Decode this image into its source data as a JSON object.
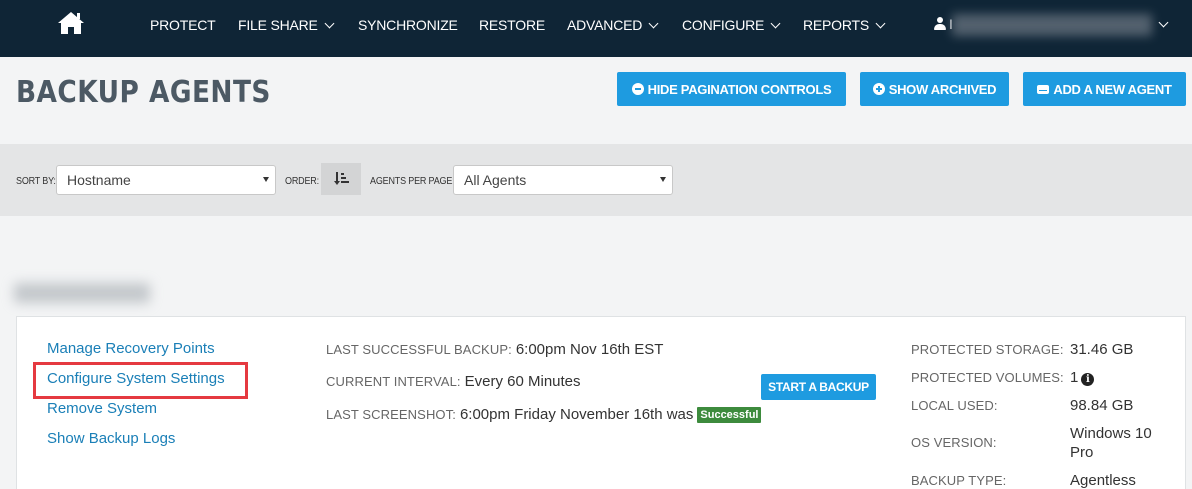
{
  "nav": {
    "items": [
      {
        "label": "PROTECT",
        "dropdown": false
      },
      {
        "label": "FILE SHARE",
        "dropdown": true
      },
      {
        "label": "SYNCHRONIZE",
        "dropdown": false
      },
      {
        "label": "RESTORE",
        "dropdown": false
      },
      {
        "label": "ADVANCED",
        "dropdown": true
      },
      {
        "label": "CONFIGURE",
        "dropdown": true
      },
      {
        "label": "REPORTS",
        "dropdown": true
      }
    ],
    "user_initial": "I",
    "icons": {
      "home": "home-icon",
      "user": "user-icon"
    }
  },
  "page": {
    "title": "BACKUP AGENTS",
    "buttons": {
      "hide_pagination": "HIDE PAGINATION CONTROLS",
      "show_archived": "SHOW ARCHIVED",
      "add_agent": "ADD A NEW AGENT"
    }
  },
  "filters": {
    "sort_by_label": "SORT BY:",
    "sort_by_value": "Hostname",
    "order_label": "ORDER:",
    "per_page_label": "AGENTS PER PAGE:",
    "per_page_value": "All Agents"
  },
  "agent": {
    "links": {
      "manage_recovery": "Manage Recovery Points",
      "configure_settings": "Configure System Settings",
      "remove_system": "Remove System",
      "show_logs": "Show Backup Logs"
    },
    "last_backup_label": "LAST SUCCESSFUL BACKUP:",
    "last_backup_value": "6:00pm Nov 16th EST",
    "interval_label": "CURRENT INTERVAL:",
    "interval_value": "Every 60 Minutes",
    "screenshot_label": "LAST SCREENSHOT:",
    "screenshot_value": "6:00pm Friday November 16th was",
    "screenshot_status": "Successful",
    "start_backup": "START A BACKUP",
    "stats": {
      "protected_storage_label": "PROTECTED STORAGE:",
      "protected_storage_value": "31.46 GB",
      "protected_volumes_label": "PROTECTED VOLUMES:",
      "protected_volumes_value": "1",
      "local_used_label": "LOCAL USED:",
      "local_used_value": "98.84 GB",
      "os_version_label": "OS VERSION:",
      "os_version_value": "Windows 10 Pro",
      "backup_type_label": "BACKUP TYPE:",
      "backup_type_value": "Agentless"
    }
  },
  "colors": {
    "nav_bg": "#0f2536",
    "accent": "#1e9be0",
    "link": "#1a7fb7",
    "success": "#3d8b3d",
    "highlight": "#e53940"
  }
}
